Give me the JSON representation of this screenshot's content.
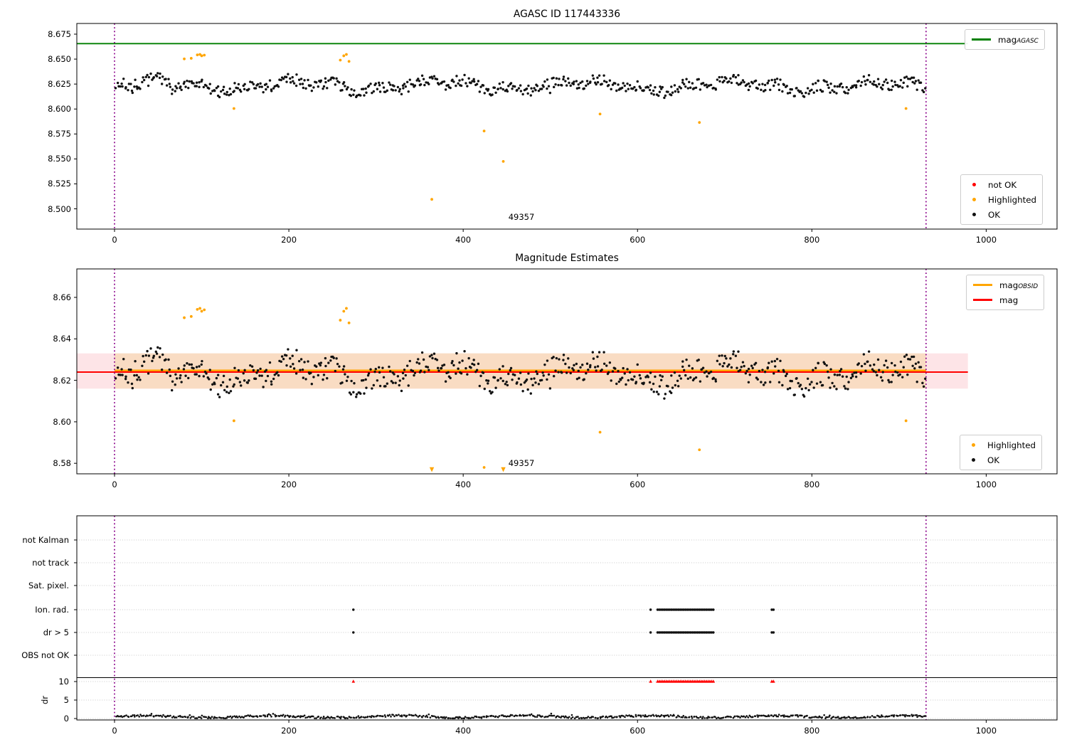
{
  "colors": {
    "green": "#008000",
    "red": "#ff0000",
    "orange": "#ffa500",
    "purple": "#8a008a",
    "black_marker": "#111111",
    "grid": "#c8c8c8",
    "band_light": "#fde4e7",
    "band_dark": "#f9dcc3",
    "spine": "#000000"
  },
  "chart_data": [
    {
      "type": "scatter",
      "title": "AGASC ID 117443336",
      "xlim": [
        -43,
        1081
      ],
      "ylim": [
        8.4797,
        8.6857
      ],
      "xticks": [
        0,
        200,
        400,
        600,
        800,
        1000
      ],
      "yticks": [
        8.675,
        8.65,
        8.625,
        8.6,
        8.575,
        8.55,
        8.525,
        8.5
      ],
      "ytick_labels": [
        "8.675",
        "8.650",
        "8.625",
        "8.600",
        "8.575",
        "8.550",
        "8.525",
        "8.500"
      ],
      "mag_agasc_line": {
        "y": 8.6655,
        "x_range": [
          -43,
          979
        ],
        "color_key": "green"
      },
      "vlines_x": [
        0,
        931
      ],
      "annotation": {
        "text": "49357",
        "x": 467,
        "y": 8.4935
      },
      "legend_top": [
        {
          "label": "mag",
          "sub": "AGASC",
          "kind": "line",
          "color_key": "green"
        }
      ],
      "legend_bottom": [
        {
          "label": "not OK",
          "kind": "dot",
          "color_key": "red"
        },
        {
          "label": "Highlighted",
          "kind": "dot",
          "color_key": "orange"
        },
        {
          "label": "OK",
          "kind": "dot",
          "color_key": "black_marker"
        }
      ],
      "ok_scatter_summary": {
        "count": 640,
        "x_range": [
          2,
          930
        ],
        "mean_mag": 8.6235,
        "min_mag": 8.6005,
        "max_mag": 8.6478,
        "seed": 7,
        "wave1_amp": 0.0042,
        "wave1_period": 26.5,
        "wave2_amp": 0.0028,
        "wave2_period": 8.1,
        "noise_half_range": 0.0058
      },
      "highlighted_points": [
        [
          80,
          8.6502
        ],
        [
          88,
          8.6508
        ],
        [
          95,
          8.6542
        ],
        [
          98,
          8.6547
        ],
        [
          100,
          8.6533
        ],
        [
          103,
          8.654
        ],
        [
          137,
          8.6005
        ],
        [
          259,
          8.649
        ],
        [
          263,
          8.6533
        ],
        [
          266,
          8.6547
        ],
        [
          269,
          8.6477
        ],
        [
          364,
          8.5095
        ],
        [
          424,
          8.578
        ],
        [
          446,
          8.5475
        ],
        [
          557,
          8.595
        ],
        [
          671,
          8.5865
        ],
        [
          908,
          8.6005
        ]
      ]
    },
    {
      "type": "scatter",
      "title": "Magnitude Estimates",
      "xlim": [
        -43,
        1081
      ],
      "ylim": [
        8.575,
        8.6737
      ],
      "xticks": [
        0,
        200,
        400,
        600,
        800,
        1000
      ],
      "yticks": [
        8.66,
        8.64,
        8.62,
        8.6,
        8.58
      ],
      "ytick_labels": [
        "8.66",
        "8.64",
        "8.62",
        "8.60",
        "8.58"
      ],
      "mag_line": {
        "y": 8.624,
        "x_range": [
          -43,
          979
        ],
        "color_key": "red"
      },
      "mag_obsid_line": {
        "y": 8.6245,
        "x_range": [
          0,
          931
        ],
        "color_key": "orange"
      },
      "uncertainty_band": {
        "y_range": [
          8.616,
          8.633
        ],
        "full_span_color_key": "band_light",
        "data_span_color_key": "band_dark"
      },
      "vlines_x": [
        0,
        931
      ],
      "annotation": {
        "text": "49357",
        "x": 467,
        "y": 8.578
      },
      "legend_top": [
        {
          "label": "mag",
          "sub": "OBSID",
          "kind": "line",
          "color_key": "orange"
        },
        {
          "label": "mag",
          "sub": "",
          "kind": "line",
          "color_key": "red"
        }
      ],
      "legend_bottom": [
        {
          "label": "Highlighted",
          "kind": "dot",
          "color_key": "orange"
        },
        {
          "label": "OK",
          "kind": "dot",
          "color_key": "black_marker"
        }
      ],
      "shares_points_with_plot": 0,
      "offscale_low_marker": "orange down-triangle at axis bottom"
    },
    {
      "type": "flags_and_dr",
      "flag_categories": [
        "not Kalman",
        "not track",
        "Sat. pixel.",
        "Ion. rad.",
        "dr > 5",
        "OBS not OK"
      ],
      "dr_axis_label": "dr",
      "dr_ticks": [
        10,
        5,
        0
      ],
      "dr_tick_labels": [
        "10",
        "5",
        "0"
      ],
      "xticks": [
        0,
        200,
        400,
        600,
        800,
        1000
      ],
      "vlines_x": [
        0,
        931
      ],
      "flagged_rows": [
        "Ion. rad.",
        "dr > 5"
      ],
      "flagged_x": [
        274,
        615,
        623,
        625,
        627,
        629,
        631,
        633,
        635,
        637,
        639,
        641,
        643,
        645,
        647,
        649,
        651,
        653,
        655,
        657,
        659,
        661,
        663,
        665,
        667,
        669,
        671,
        673,
        675,
        677,
        679,
        681,
        683,
        685,
        687,
        754,
        756
      ],
      "dr_clipped_at_10_note": "red markers at dr=10 for same x values as flagged_x",
      "dr_trace_summary": {
        "count": 640,
        "x_range": [
          2,
          930
        ],
        "base": 0.5,
        "seed": 11,
        "wave_amp": 0.28,
        "wave_period": 23,
        "noise_half_range": 0.28,
        "min": 0.06
      }
    }
  ]
}
